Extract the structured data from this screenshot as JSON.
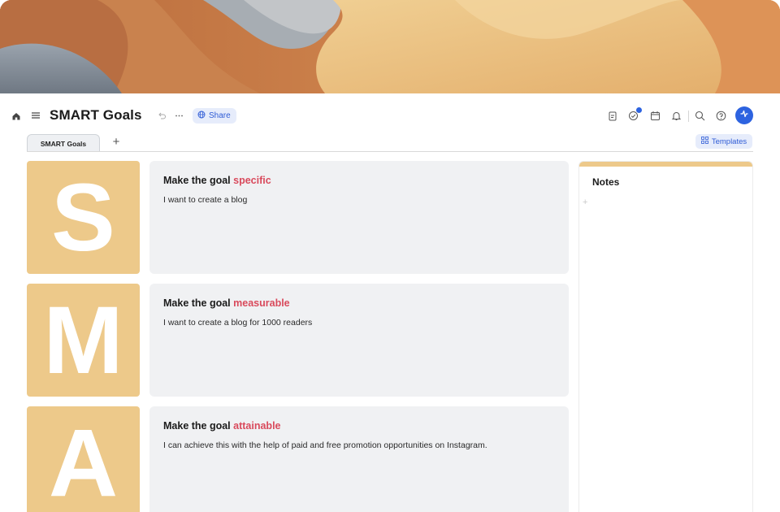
{
  "toolbar": {
    "title": "SMART Goals",
    "share_label": "Share",
    "icons": [
      "home-icon",
      "menu-icon",
      "undo-icon",
      "more-icon",
      "globe-icon",
      "clipboard-icon",
      "check-circle-icon",
      "calendar-icon",
      "bell-icon",
      "search-icon",
      "help-icon",
      "sparkle-icon"
    ],
    "accent_color": "#2d63e0"
  },
  "tabs": [
    {
      "label": "SMART Goals",
      "active": true
    }
  ],
  "templates_label": "Templates",
  "rows": [
    {
      "letter": "S",
      "heading_prefix": "Make the goal ",
      "heading_accent": "specific",
      "body": "I want to create a blog"
    },
    {
      "letter": "M",
      "heading_prefix": "Make the goal ",
      "heading_accent": "measurable",
      "body": "I want to create a blog for 1000 readers"
    },
    {
      "letter": "A",
      "heading_prefix": "Make the goal ",
      "heading_accent": "attainable",
      "body": "I can achieve this with the help of paid and free promotion opportunities on Instagram."
    }
  ],
  "notes": {
    "title": "Notes"
  },
  "colors": {
    "letter_tile": "#edc98a",
    "accent_text": "#d94a5c",
    "card_bg": "#f0f1f3"
  }
}
